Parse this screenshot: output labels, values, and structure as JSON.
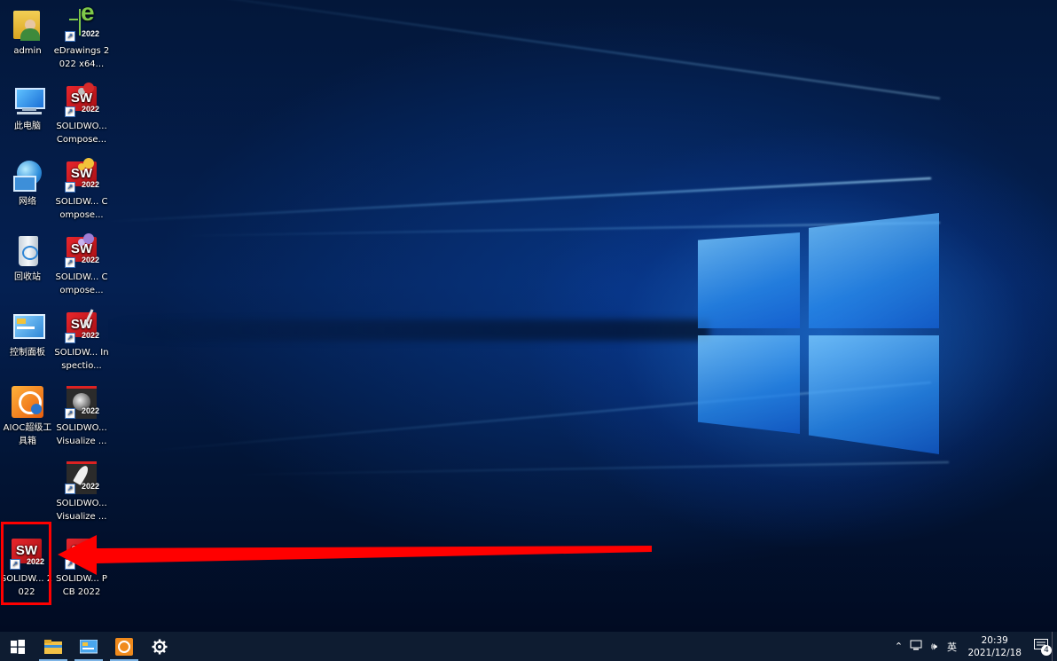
{
  "desktop": {
    "icons": [
      {
        "label": "admin"
      },
      {
        "label": "此电脑"
      },
      {
        "label": "网络"
      },
      {
        "label": "回收站"
      },
      {
        "label": "控制面板"
      },
      {
        "label": "AIOC超级工具箱"
      },
      {
        "label": "eDrawings 2022 x64..."
      },
      {
        "label": "SOLIDWO... Compose...",
        "badge": "2022"
      },
      {
        "label": "SOLIDW... Compose...",
        "badge": "2022"
      },
      {
        "label": "SOLIDW... Compose...",
        "badge": "2022"
      },
      {
        "label": "SOLIDW... Inspectio...",
        "badge": "2022"
      },
      {
        "label": "SOLIDWO... Visualize ...",
        "badge": "2022"
      },
      {
        "label": "SOLIDWO... Visualize ...",
        "badge": "2022"
      },
      {
        "label": "SOLIDW... 2022",
        "badge": "2022"
      },
      {
        "label": "SOLIDW... PCB 2022"
      }
    ],
    "sw_text": "SW",
    "highlight_color": "#ff0000"
  },
  "taskbar": {
    "tray": {
      "ime": "英",
      "time": "20:39",
      "date": "2021/12/18",
      "notification_count": "4"
    }
  }
}
